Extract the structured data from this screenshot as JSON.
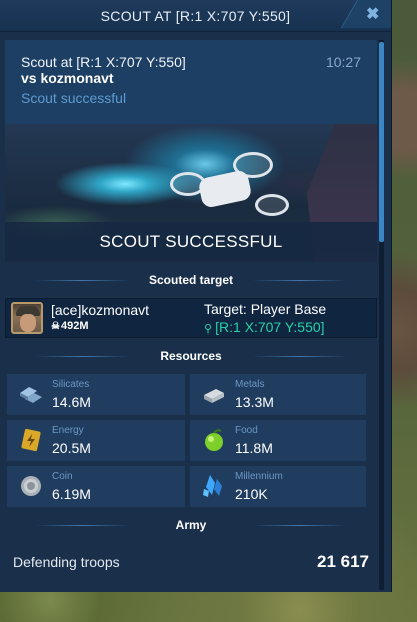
{
  "window": {
    "title": "SCOUT AT [R:1 X:707 Y:550]",
    "close_icon": "close-icon"
  },
  "message": {
    "title": "Scout at [R:1 X:707 Y:550]",
    "time": "10:27",
    "vs": "vs kozmonavt",
    "status": "Scout successful"
  },
  "banner": {
    "text": "SCOUT SUCCESSFUL"
  },
  "scouted_target": {
    "heading": "Scouted target",
    "player_name": "[ace]kozmonavt",
    "power_icon": "skull-icon",
    "power": "492M",
    "target_type": "Target: Player Base",
    "location_icon": "map-pin-icon",
    "location": "[R:1 X:707 Y:550]"
  },
  "resources": {
    "heading": "Resources",
    "items": [
      {
        "label": "Silicates",
        "value": "14.6M",
        "icon": "silicates-icon"
      },
      {
        "label": "Metals",
        "value": "13.3M",
        "icon": "metals-icon"
      },
      {
        "label": "Energy",
        "value": "20.5M",
        "icon": "energy-icon"
      },
      {
        "label": "Food",
        "value": "11.8M",
        "icon": "food-icon"
      },
      {
        "label": "Coin",
        "value": "6.19M",
        "icon": "coin-icon"
      },
      {
        "label": "Millennium",
        "value": "210K",
        "icon": "millennium-icon"
      }
    ]
  },
  "army": {
    "heading": "Army",
    "defending_label": "Defending troops",
    "defending_value": "21 617"
  }
}
